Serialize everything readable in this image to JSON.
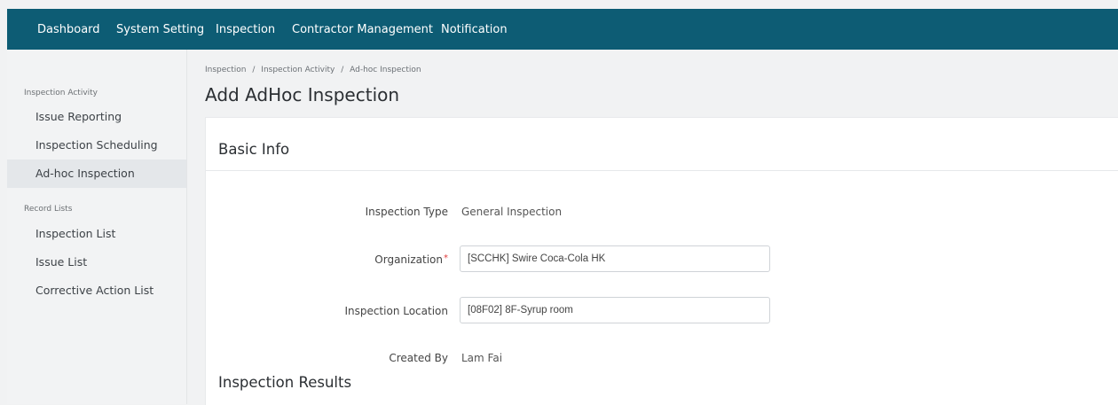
{
  "top_nav": {
    "items": [
      {
        "label": "Dashboard"
      },
      {
        "label": "System Setting"
      },
      {
        "label": "Inspection"
      },
      {
        "label": "Contractor Management"
      },
      {
        "label": "Notification"
      }
    ]
  },
  "sidebar": {
    "sections": [
      {
        "heading": "Inspection Activity",
        "items": [
          {
            "label": "Issue Reporting"
          },
          {
            "label": "Inspection Scheduling"
          },
          {
            "label": "Ad-hoc Inspection",
            "active": true
          }
        ]
      },
      {
        "heading": "Record Lists",
        "items": [
          {
            "label": "Inspection List"
          },
          {
            "label": "Issue List"
          },
          {
            "label": "Corrective Action List"
          }
        ]
      }
    ]
  },
  "breadcrumb": {
    "items": [
      "Inspection",
      "Inspection Activity",
      "Ad-hoc Inspection"
    ],
    "separator": "/"
  },
  "page": {
    "title": "Add AdHoc Inspection"
  },
  "basic_info": {
    "title": "Basic Info",
    "inspection_type": {
      "label": "Inspection Type",
      "value": "General Inspection"
    },
    "organization": {
      "label": "Organization",
      "required_mark": "*",
      "value": "[SCCHK] Swire Coca-Cola HK"
    },
    "inspection_location": {
      "label": "Inspection Location",
      "value": "[08F02] 8F-Syrup room"
    },
    "created_by": {
      "label": "Created By",
      "value": "Lam Fai"
    }
  },
  "inspection_results": {
    "title": "Inspection Results"
  },
  "colors": {
    "nav_bg": "#0d5c74",
    "required": "#e03a3a"
  }
}
